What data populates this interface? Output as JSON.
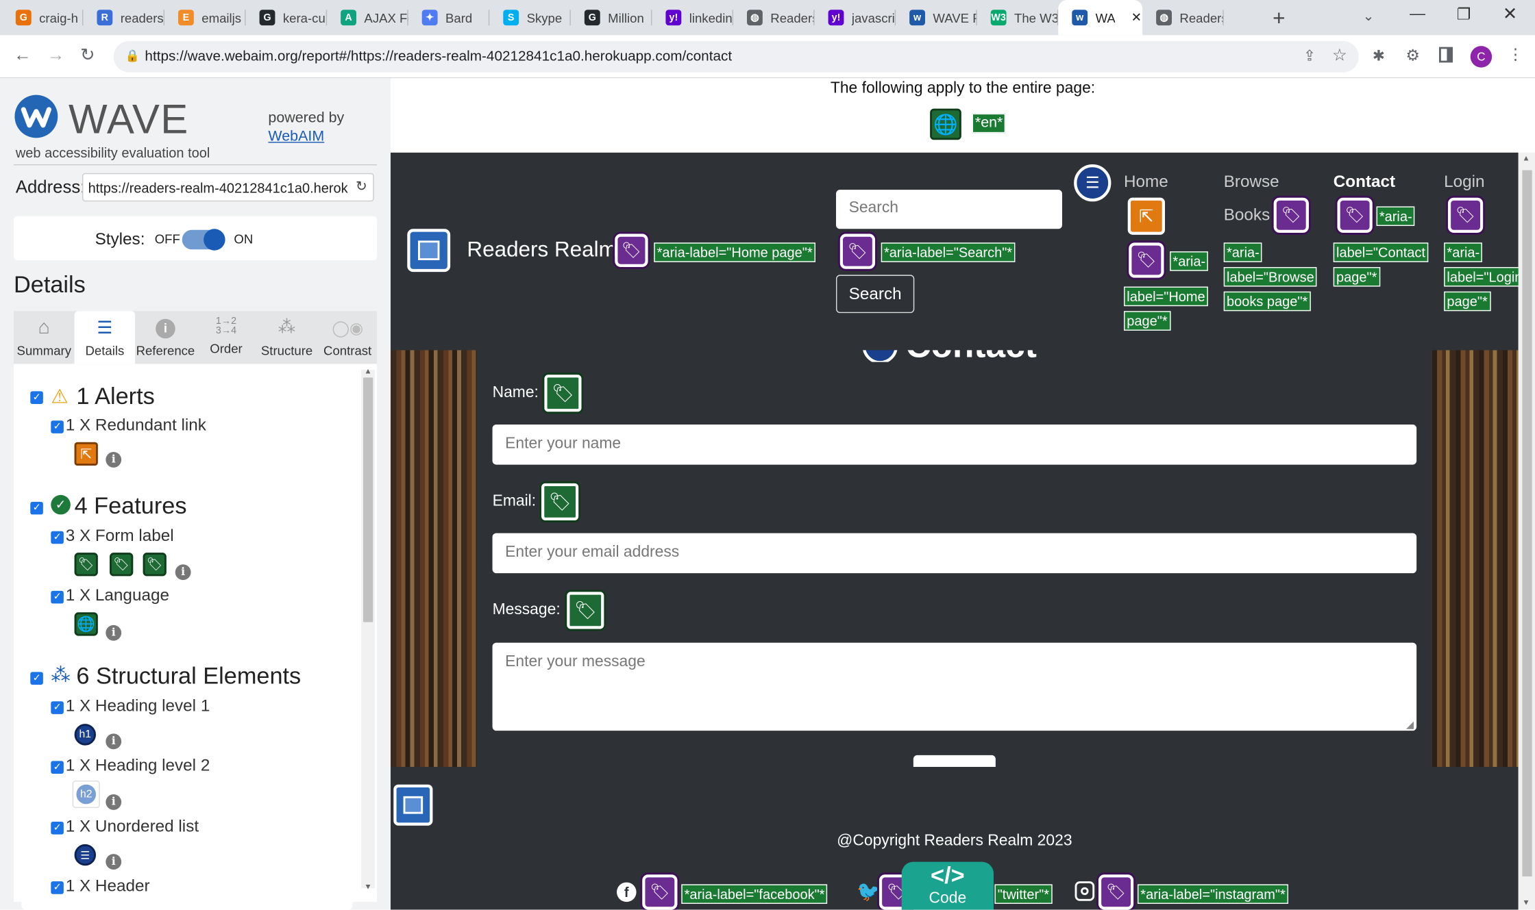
{
  "browser": {
    "tabs": [
      {
        "title": "craig-h",
        "icon": "google-icon",
        "color": "#e8710a",
        "glyph": "G"
      },
      {
        "title": "readers",
        "icon": "app-icon",
        "color": "#3a6fd8",
        "glyph": "R"
      },
      {
        "title": "emailjs",
        "icon": "emailjs-icon",
        "color": "#f28c28",
        "glyph": "E"
      },
      {
        "title": "kera-cu",
        "icon": "github-icon",
        "color": "#24292e",
        "glyph": "G"
      },
      {
        "title": "AJAX Fc",
        "icon": "chatgpt-icon",
        "color": "#10a37f",
        "glyph": "A"
      },
      {
        "title": "Bard",
        "icon": "bard-icon",
        "color": "#4f7cf2",
        "glyph": "✦"
      },
      {
        "title": "Skype",
        "icon": "skype-icon",
        "color": "#00aff0",
        "glyph": "S"
      },
      {
        "title": "Million",
        "icon": "github-icon",
        "color": "#24292e",
        "glyph": "G"
      },
      {
        "title": "linkedin",
        "icon": "yahoo-icon",
        "color": "#6001d2",
        "glyph": "y!"
      },
      {
        "title": "Readers",
        "icon": "globe-icon",
        "color": "#5f6368",
        "glyph": "◍"
      },
      {
        "title": "javascri",
        "icon": "yahoo-icon",
        "color": "#6001d2",
        "glyph": "y!"
      },
      {
        "title": "WAVE R",
        "icon": "wave-icon",
        "color": "#1e5aa8",
        "glyph": "w"
      },
      {
        "title": "The W3",
        "icon": "w3schools-icon",
        "color": "#04aa6d",
        "glyph": "W3"
      },
      {
        "title": "WA",
        "icon": "wave-icon",
        "color": "#1e5aa8",
        "glyph": "w"
      },
      {
        "title": "Readers",
        "icon": "globe-icon",
        "color": "#5f6368",
        "glyph": "◍"
      }
    ],
    "url": "https://wave.webaim.org/report#/https://readers-realm-40212841c1a0.herokuapp.com/contact",
    "profile_initial": "C"
  },
  "wave": {
    "logo_text": "WAVE",
    "tagline": "web accessibility evaluation tool",
    "powered_by": "powered by",
    "webaim_link": "WebAIM",
    "address_label": "Address:",
    "address_value": "https://readers-realm-40212841c1a0.herok",
    "styles_label": "Styles:",
    "styles_off": "OFF",
    "styles_on": "ON",
    "details_title": "Details",
    "tabs": [
      "Summary",
      "Details",
      "Reference",
      "Order",
      "Structure",
      "Contrast"
    ],
    "alerts": {
      "title": "1 Alerts",
      "items": [
        "1 X Redundant link"
      ]
    },
    "features": {
      "title": "4 Features",
      "items": [
        "3 X Form label",
        "1 X Language"
      ]
    },
    "structure": {
      "title": "6 Structural Elements",
      "items": [
        "1 X Heading level 1",
        "1 X Heading level 2",
        "1 X Unordered list",
        "1 X Header"
      ]
    }
  },
  "page": {
    "entire_page_text": "The following apply to the entire page:",
    "lang_label": "*en*",
    "brand": "Readers Realm",
    "aria_home": "*aria-label=\"Home page\"*",
    "search_placeholder": "Search",
    "aria_search": "*aria-label=\"Search\"*",
    "search_button": "Search",
    "nav_home": "Home",
    "nav_browse": "Browse",
    "nav_books": "Books",
    "nav_contact": "Contact",
    "nav_login": "Login",
    "aria_nav_home_1": "*aria-",
    "aria_nav_home_2": "label=\"Home",
    "aria_nav_home_3": "page\"*",
    "aria_browse_1": "*aria-",
    "aria_browse_2": "label=\"Browse",
    "aria_browse_3": "books page\"*",
    "aria_contact_1": "*aria-",
    "aria_contact_2": "label=\"Contact",
    "aria_contact_3": "page\"*",
    "aria_login_1": "*aria-",
    "aria_login_2": "label=\"Login",
    "aria_login_3": "page\"*",
    "heading_fragment": "Contact",
    "name_label": "Name:",
    "name_placeholder": "Enter your name",
    "email_label": "Email:",
    "email_placeholder": "Enter your email address",
    "message_label": "Message:",
    "message_placeholder": "Enter your message",
    "copyright": "@Copyright Readers Realm 2023",
    "aria_facebook": "*aria-label=\"facebook\"*",
    "aria_twitter": "\"twitter\"*",
    "aria_instagram": "*aria-label=\"instagram\"*",
    "code_glyph": "</>",
    "code_label": "Code"
  }
}
